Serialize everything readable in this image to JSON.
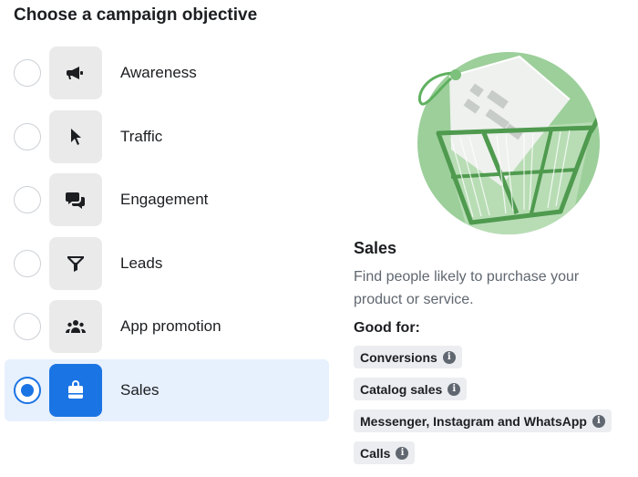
{
  "page": {
    "title": "Choose a campaign objective"
  },
  "objectives": [
    {
      "label": "Awareness",
      "icon": "megaphone-icon",
      "selected": false
    },
    {
      "label": "Traffic",
      "icon": "cursor-icon",
      "selected": false
    },
    {
      "label": "Engagement",
      "icon": "chat-bubbles-icon",
      "selected": false
    },
    {
      "label": "Leads",
      "icon": "funnel-icon",
      "selected": false
    },
    {
      "label": "App promotion",
      "icon": "people-icon",
      "selected": false
    },
    {
      "label": "Sales",
      "icon": "shopping-bag-icon",
      "selected": true
    }
  ],
  "detail": {
    "title": "Sales",
    "description": "Find people likely to purchase your product or service.",
    "good_for_label": "Good for:",
    "good_for": [
      {
        "label": "Conversions",
        "icon": "info-icon"
      },
      {
        "label": "Catalog sales",
        "icon": "info-icon"
      },
      {
        "label": "Messenger, Instagram and WhatsApp",
        "icon": "info-icon"
      },
      {
        "label": "Calls",
        "icon": "info-icon"
      }
    ]
  },
  "colors": {
    "accent": "#1b74e4",
    "selected_bg": "#e7f0fd",
    "illustration_green": "#9ccf9a"
  }
}
